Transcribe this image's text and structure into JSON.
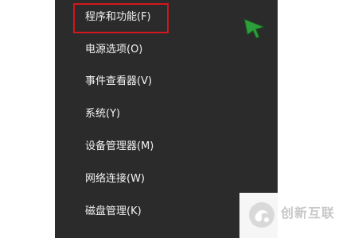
{
  "context_menu": {
    "items": [
      {
        "label": "程序和功能(F)",
        "highlighted": true
      },
      {
        "label": "电源选项(O)"
      },
      {
        "label": "事件查看器(V)"
      },
      {
        "label": "系统(Y)"
      },
      {
        "label": "设备管理器(M)"
      },
      {
        "label": "网络连接(W)"
      },
      {
        "label": "磁盘管理(K)"
      }
    ],
    "background_color": "#2b2b2b",
    "text_color": "#f2f2f2",
    "highlight_color": "#d4161d"
  },
  "cursor": {
    "icon": "green-arrow-cursor-icon",
    "color": "#2e9e3a"
  },
  "watermark": {
    "text": "创新互联",
    "icon": "logo-icon",
    "color": "#c8c8c8"
  }
}
